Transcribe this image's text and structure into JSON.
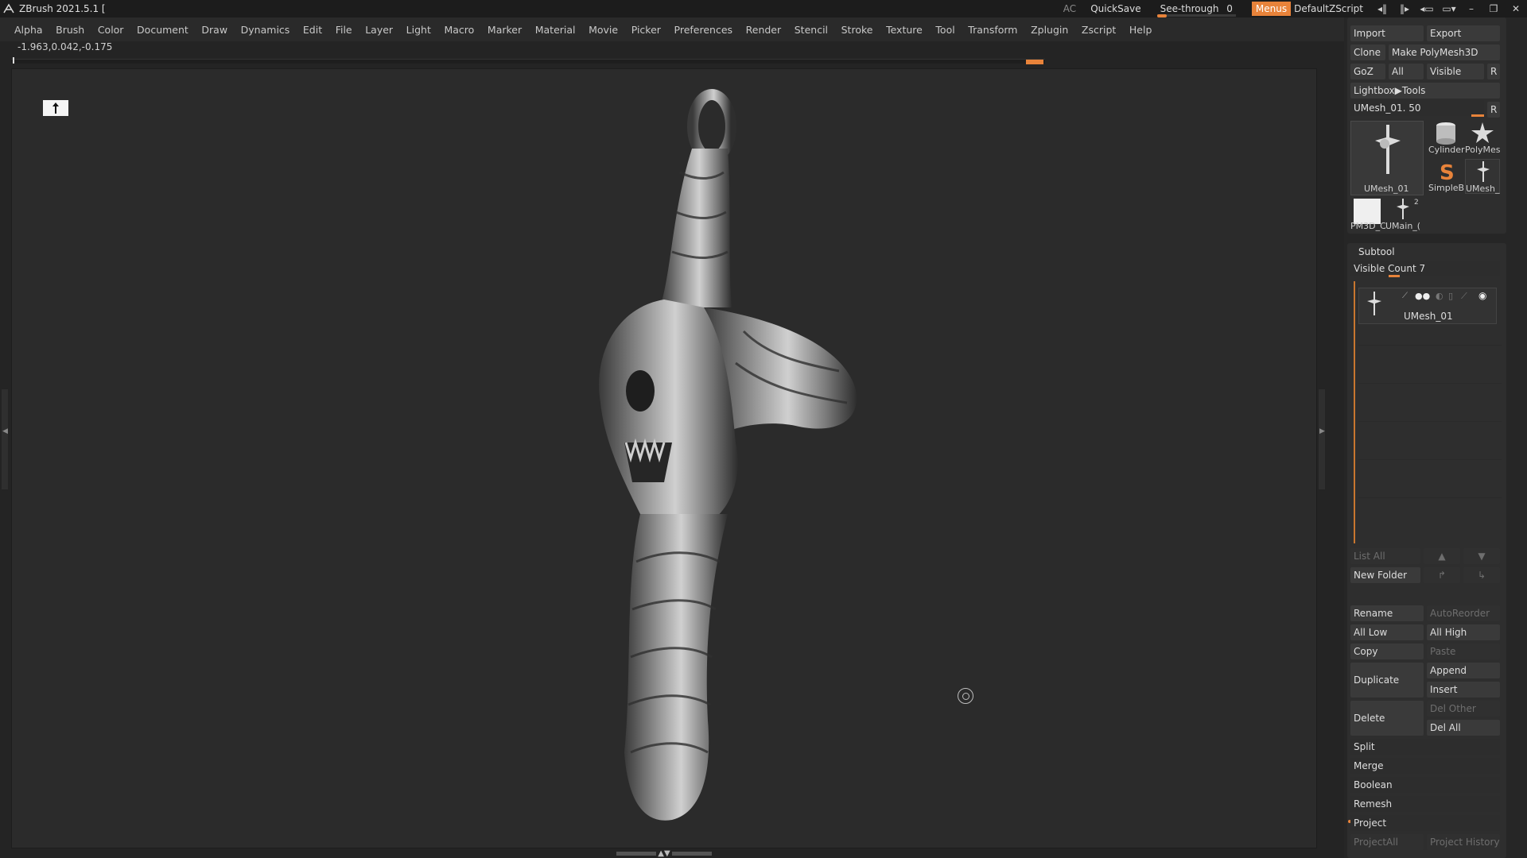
{
  "title_bar": {
    "app_title": "ZBrush 2021.5.1 [",
    "ac_label": "AC",
    "quicksave_label": "QuickSave",
    "seethrough_label": "See-through",
    "seethrough_value": "0",
    "menus_label": "Menus",
    "script_label": "DefaultZScript"
  },
  "menu_bar": {
    "items": [
      "Alpha",
      "Brush",
      "Color",
      "Document",
      "Draw",
      "Dynamics",
      "Edit",
      "File",
      "Layer",
      "Light",
      "Macro",
      "Marker",
      "Material",
      "Movie",
      "Picker",
      "Preferences",
      "Render",
      "Stencil",
      "Stroke",
      "Texture",
      "Tool",
      "Transform",
      "Zplugin",
      "Zscript",
      "Help"
    ]
  },
  "info": {
    "coordinates": "-1.963,0.042,-0.175"
  },
  "tool_panel": {
    "import_label": "Import",
    "export_label": "Export",
    "clone_label": "Clone",
    "make_polymesh_label": "Make PolyMesh3D",
    "goz_label": "GoZ",
    "all_label": "All",
    "visible_label": "Visible",
    "r_label": "R",
    "lightbox_label": "Lightbox▶Tools",
    "current_tool_label": "UMesh_01. 50",
    "r2_label": "R",
    "thumbs": {
      "main": "UMesh_01",
      "cylinder": "Cylinder",
      "polymesh": "PolyMes",
      "simpleb": "SimpleB",
      "umesh_small": "UMesh_",
      "pm3d": "PM3D_C",
      "umain": "UMain_(",
      "count_badge": "2"
    }
  },
  "subtool_panel": {
    "header": "Subtool",
    "visible_count_label": "Visible Count 7",
    "active_subtool_name": "UMesh_01",
    "list_all_label": "List All",
    "new_folder_label": "New Folder",
    "rename_label": "Rename",
    "autoreorder_label": "AutoReorder",
    "all_low_label": "All Low",
    "all_high_label": "All High",
    "copy_label": "Copy",
    "paste_label": "Paste",
    "duplicate_label": "Duplicate",
    "append_label": "Append",
    "insert_label": "Insert",
    "delete_label": "Delete",
    "del_other_label": "Del Other",
    "del_all_label": "Del All",
    "split_label": "Split",
    "merge_label": "Merge",
    "boolean_label": "Boolean",
    "remesh_label": "Remesh",
    "project_label": "Project",
    "projectall_label": "ProjectAll",
    "project_history_label": "Project History"
  },
  "colors": {
    "accent": "#e8833a",
    "background": "#242424",
    "canvas": "#2b2b2b"
  }
}
